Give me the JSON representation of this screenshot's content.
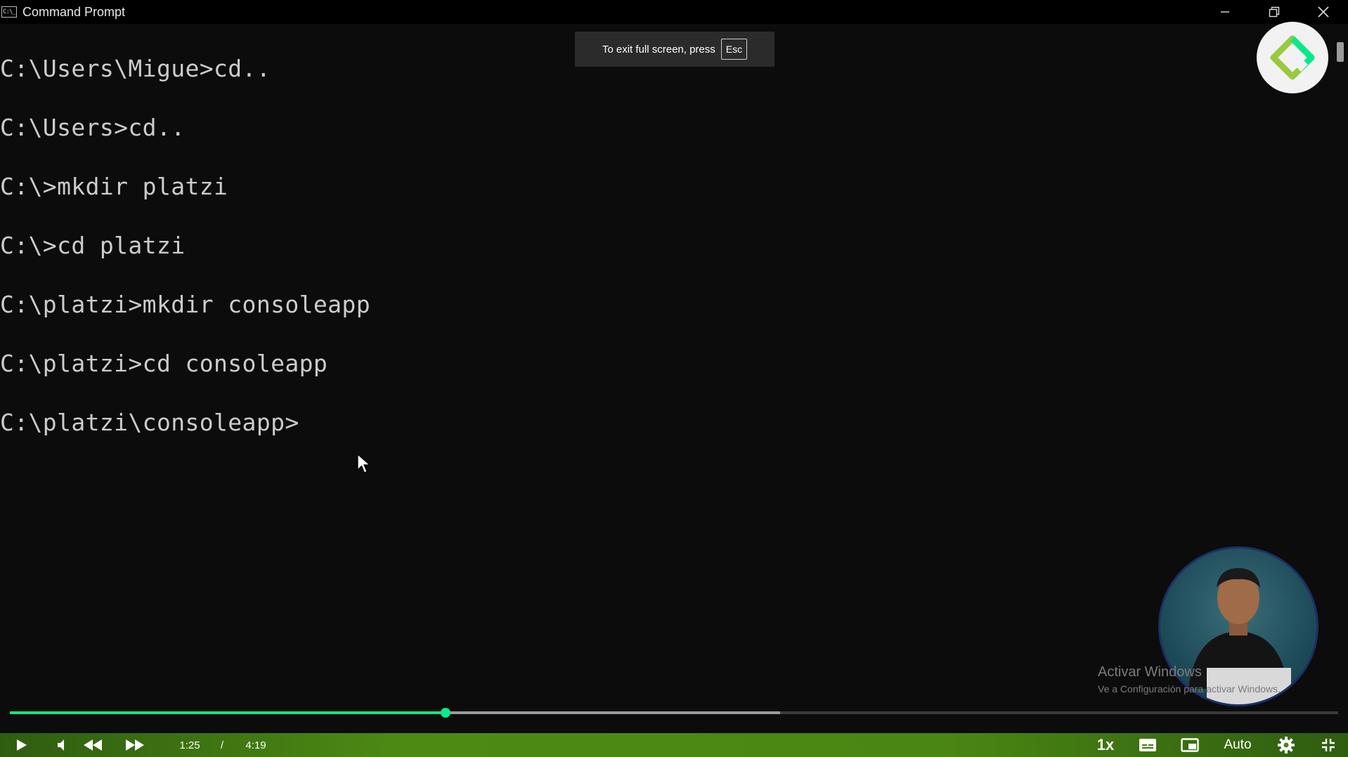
{
  "window": {
    "title": "Command Prompt",
    "icon_label": "C:\\_"
  },
  "terminal": {
    "lines": [
      "C:\\Users\\Migue>cd..",
      "C:\\Users>cd..",
      "C:\\>mkdir platzi",
      "C:\\>cd platzi",
      "C:\\platzi>mkdir consoleapp",
      "C:\\platzi>cd consoleapp",
      "C:\\platzi\\consoleapp>"
    ]
  },
  "fullscreen_toast": {
    "text": "To exit full screen, press",
    "key": "Esc"
  },
  "watermark": {
    "title": "Activar Windows",
    "subtitle": "Ve a Configuración para activar Windows."
  },
  "player": {
    "current_time": "1:25",
    "separator": "/",
    "duration": "4:19",
    "progress_fraction": 0.328,
    "buffered_fraction": 0.58,
    "speed_label": "1x",
    "quality_label": "Auto",
    "accent_color": "#0ae98a",
    "bar_color": "#4a8613"
  },
  "icons": {
    "play": "play-icon",
    "volume": "volume-icon",
    "rewind": "rewind-icon",
    "forward": "forward-icon",
    "captions": "captions-icon",
    "pip": "picture-in-picture-icon",
    "settings": "gear-icon",
    "exit_fullscreen": "exit-fullscreen-icon"
  }
}
